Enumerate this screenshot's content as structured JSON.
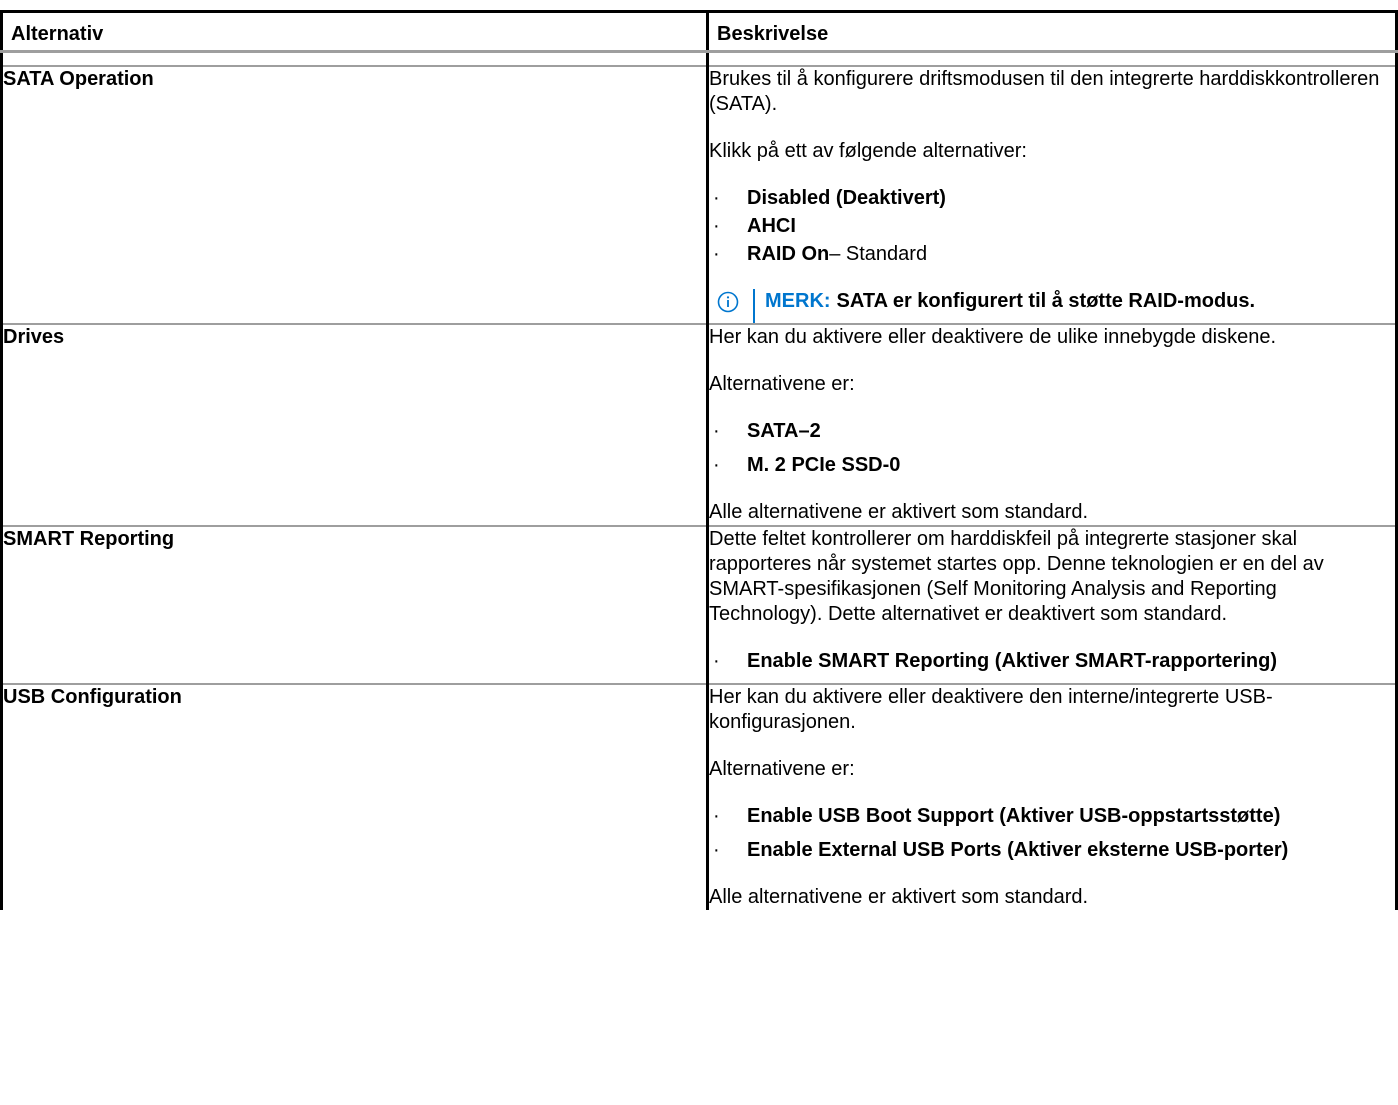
{
  "header": {
    "col_option": "Alternativ",
    "col_description": "Beskrivelse"
  },
  "rows": [
    {
      "option": "SATA Operation",
      "desc1": "Brukes til å konfigurere driftsmodusen til den integrerte harddiskkontrolleren (SATA).",
      "desc2": "Klikk på ett av følgende alternativer:",
      "items": [
        {
          "label": "Disabled (Deaktivert)",
          "suffix": ""
        },
        {
          "label": "AHCI",
          "suffix": ""
        },
        {
          "label": "RAID On",
          "suffix": "– Standard"
        }
      ],
      "note": {
        "label": "MERK:",
        "text": "SATA er konfigurert til å støtte RAID-modus.",
        "icon": "info-icon"
      }
    },
    {
      "option": "Drives",
      "desc1": "Her kan du aktivere eller deaktivere de ulike innebygde diskene.",
      "desc2": "Alternativene er:",
      "items": [
        {
          "label": "SATA–2"
        },
        {
          "label": "M. 2 PCIe SSD-0"
        }
      ],
      "desc3": "Alle alternativene er aktivert som standard."
    },
    {
      "option": "SMART Reporting",
      "desc1": "Dette feltet kontrollerer om harddiskfeil på integrerte stasjoner skal rapporteres når systemet startes opp. Denne teknologien er en del av SMART-spesifikasjonen (Self Monitoring Analysis and Reporting Technology). Dette alternativet er deaktivert som standard.",
      "items": [
        {
          "label": "Enable SMART Reporting (Aktiver SMART-rapportering)"
        }
      ]
    },
    {
      "option": "USB Configuration",
      "desc1": "Her kan du aktivere eller deaktivere den interne/integrerte USB-konfigurasjonen.",
      "desc2": "Alternativene er:",
      "items": [
        {
          "label": "Enable USB Boot Support (Aktiver USB-oppstartsstøtte)"
        },
        {
          "label": "Enable External USB Ports (Aktiver eksterne USB-porter)"
        }
      ],
      "desc3": "Alle alternativene er aktivert som standard."
    }
  ],
  "bullet": "·",
  "colors": {
    "note_accent": "#0076ce",
    "border": "#000000",
    "rule": "#9e9e9e"
  }
}
